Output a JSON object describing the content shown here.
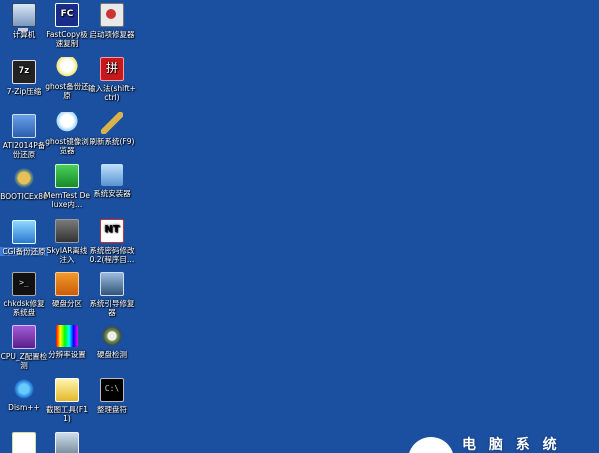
{
  "desktop": {
    "icons": [
      {
        "label": "计算机",
        "glyph": "computer-icon"
      },
      {
        "label": "FastCopy极速复制",
        "glyph": "fastcopy-icon",
        "text": "FC"
      },
      {
        "label": "启动项修复器",
        "glyph": "toolbox-icon"
      },
      {
        "label": "7-Zip压缩",
        "glyph": "sevenzip-icon",
        "text": "7z"
      },
      {
        "label": "ghost备份还原",
        "glyph": "ghost-icon"
      },
      {
        "label": "输入法(shift+ctrl)",
        "glyph": "input-method-icon",
        "text": "拼"
      },
      {
        "label": "ATI2014P备份还原",
        "glyph": "ati-icon"
      },
      {
        "label": "ghost镜像浏览器",
        "glyph": "ghost-browser-icon"
      },
      {
        "label": "刷新系统(F9)",
        "glyph": "broom-icon"
      },
      {
        "label": "BOOTICEx86",
        "glyph": "bootice-icon"
      },
      {
        "label": "MemTest Deluxe内…",
        "glyph": "memtest-icon"
      },
      {
        "label": "系统安装器",
        "glyph": "phone-icon"
      },
      {
        "label": "CGI备份还原",
        "glyph": "cgi-icon",
        "selected": true
      },
      {
        "label": "SkyIAR离线注入",
        "glyph": "skyiar-icon"
      },
      {
        "label": "系统密码修改0.2(程序目…",
        "glyph": "nt-password-icon",
        "text": "NT"
      },
      {
        "label": "chkdsk修复系统盘",
        "glyph": "terminal-icon",
        "text": ">_"
      },
      {
        "label": "硬盘分区",
        "glyph": "disk-partition-icon"
      },
      {
        "label": "系统引导修复器",
        "glyph": "boot-repair-icon"
      },
      {
        "label": "CPU_Z配置检测",
        "glyph": "cpuz-icon"
      },
      {
        "label": "分辨率设置",
        "glyph": "resolution-icon"
      },
      {
        "label": "硬盘检测",
        "glyph": "hdd-check-icon"
      },
      {
        "label": "Dism++",
        "glyph": "gear-icon"
      },
      {
        "label": "截图工具(F11)",
        "glyph": "screenshot-icon"
      },
      {
        "label": "整理盘符",
        "glyph": "cmd-icon",
        "text": "C:\\"
      },
      {
        "label": "",
        "glyph": "search-icon"
      },
      {
        "label": "",
        "glyph": "pc-user-icon"
      }
    ]
  },
  "watermark": {
    "text": "电 脑 系 统"
  },
  "colors": {
    "background": "#1b4f9f",
    "selection": "#3d7fe0"
  }
}
